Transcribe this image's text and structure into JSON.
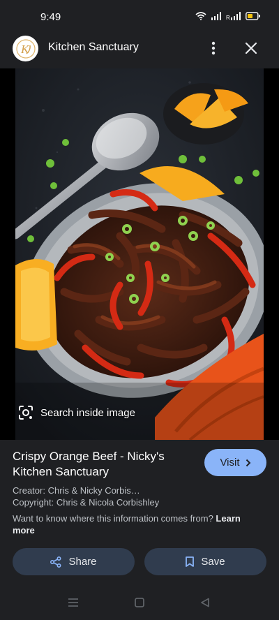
{
  "status_bar": {
    "time": "9:49",
    "icons": [
      "wifi-icon",
      "signal-icon",
      "signal-r-icon",
      "battery-icon"
    ],
    "battery_color": "#f4c20d"
  },
  "header": {
    "site_name": "Kitchen Sanctuary",
    "logo_text": "K",
    "icons": [
      "more-vert-icon",
      "close-icon"
    ]
  },
  "image": {
    "alt": "Crispy Orange Beef",
    "search_label": "Search inside image"
  },
  "result": {
    "title": "Crispy Orange Beef - Nicky's Kitchen Sanctuary",
    "visit_label": "Visit",
    "creator": "Creator: Chris & Nicky Corbis…",
    "copyright": "Copyright: Chris & Nicola Corbishley",
    "info_text": "Want to know where this information comes from?",
    "learn_more": "Learn more",
    "share_label": "Share",
    "save_label": "Save"
  },
  "colors": {
    "panel_bg": "#1f2023",
    "accent": "#8ab4f8",
    "button_bg": "#303c4e"
  },
  "nav": {
    "icons": [
      "menu-icon",
      "home-icon",
      "back-icon"
    ]
  }
}
